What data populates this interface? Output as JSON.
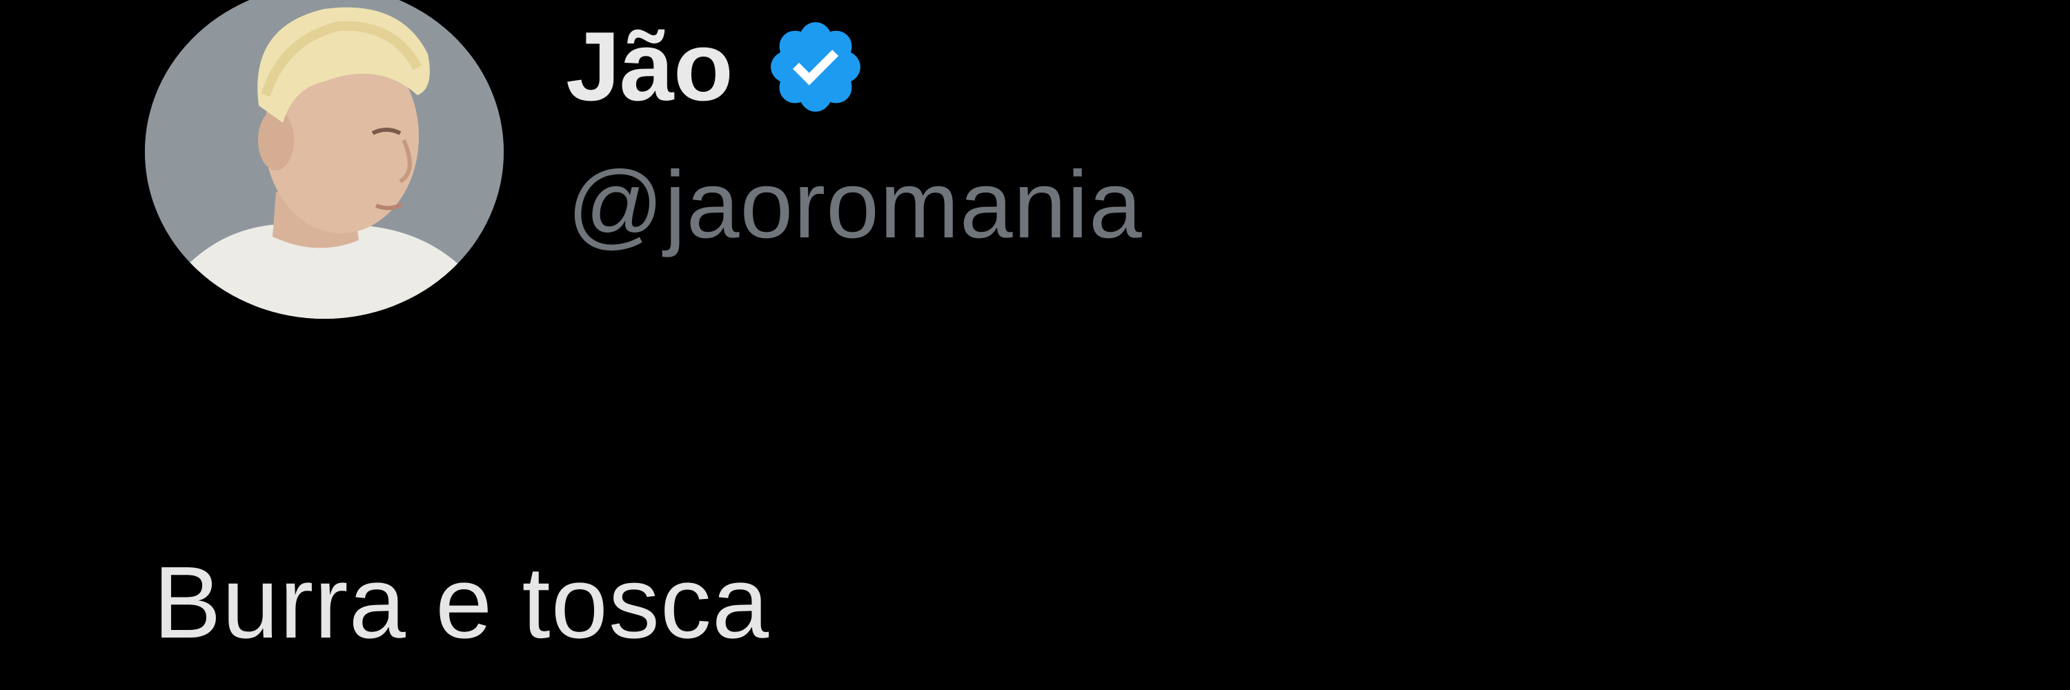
{
  "tweet": {
    "author": {
      "display_name": "Jão",
      "handle": "@jaoromania",
      "verified": true,
      "avatar_icon": "profile-photo"
    },
    "text": "Burra e tosca"
  },
  "colors": {
    "background": "#000000",
    "display_name": "#e9e9e9",
    "handle": "#6f757b",
    "body_text": "#e6e6e6",
    "verified_badge": "#1d9bf0"
  }
}
